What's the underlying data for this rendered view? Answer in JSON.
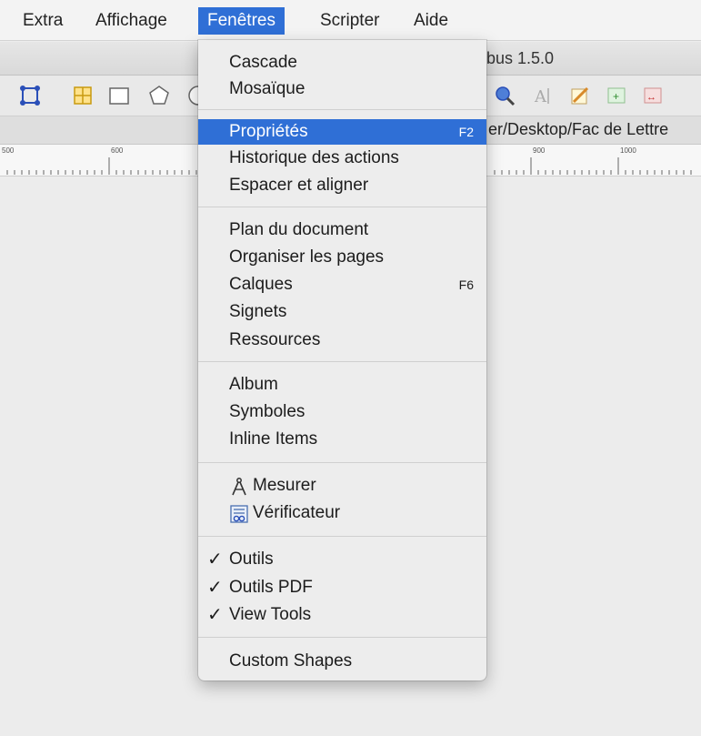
{
  "menubar": {
    "items": [
      {
        "label": "Extra"
      },
      {
        "label": "Affichage"
      },
      {
        "label": "Fenêtres"
      },
      {
        "label": "Scripter"
      },
      {
        "label": "Aide"
      }
    ]
  },
  "window": {
    "title_fragment": "bus 1.5.0",
    "path_fragment": "er/Desktop/Fac de Lettre"
  },
  "ruler": {
    "ticks": [
      "500",
      "600",
      "900",
      "1000"
    ]
  },
  "toolbar": {
    "icons": [
      "selection-icon",
      "table-icon",
      "rectangle-icon",
      "polygon-icon",
      "zoom-icon",
      "text-edit-icon",
      "eyedropper-icon",
      "link-frames-icon",
      "unlink-frames-icon"
    ]
  },
  "menu": {
    "cascade": "Cascade",
    "mosaique": "Mosaïque",
    "proprietes": "Propriétés",
    "proprietes_shortcut": "F2",
    "historique": "Historique des actions",
    "espacer": "Espacer et aligner",
    "plan": "Plan du document",
    "organiser": "Organiser les pages",
    "calques": "Calques",
    "calques_shortcut": "F6",
    "signets": "Signets",
    "ressources": "Ressources",
    "album": "Album",
    "symboles": "Symboles",
    "inline": "Inline Items",
    "mesurer": "Mesurer",
    "verificateur": "Vérificateur",
    "check": "✓",
    "outils": "Outils",
    "outils_pdf": "Outils PDF",
    "view_tools": "View Tools",
    "custom_shapes": "Custom Shapes"
  },
  "colors": {
    "highlight": "#2f6fd6"
  }
}
